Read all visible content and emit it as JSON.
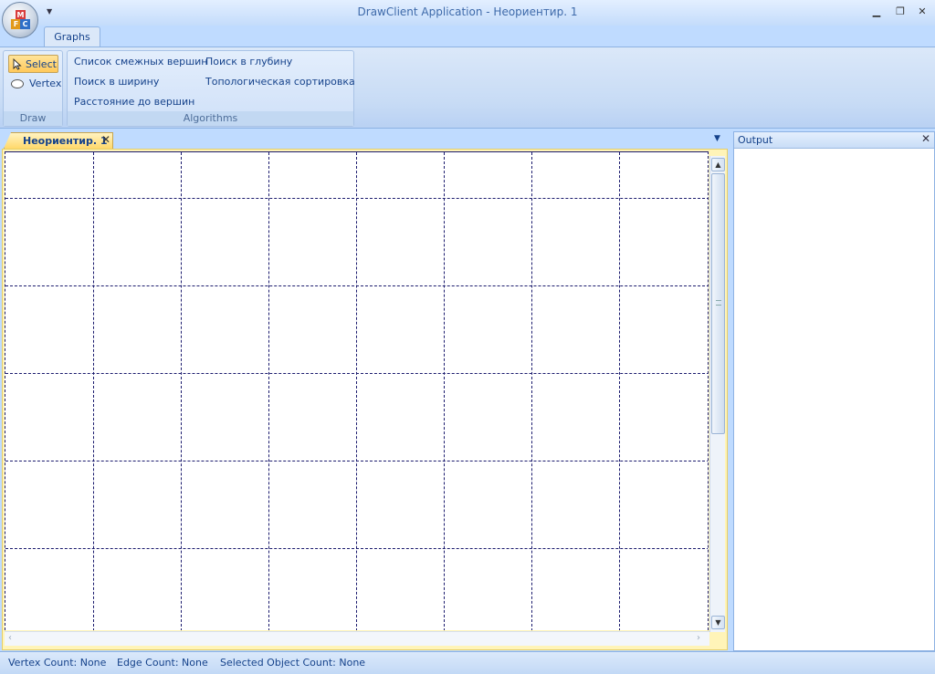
{
  "window": {
    "title": "DrawClient Application - Неориентир. 1",
    "orb_letters": [
      "M",
      "F",
      "C"
    ]
  },
  "ribbon": {
    "tabs": [
      {
        "label": "Graphs"
      }
    ],
    "groups": {
      "draw": {
        "caption": "Draw",
        "select_label": "Select",
        "vertex_label": "Vertex"
      },
      "algorithms": {
        "caption": "Algorithms",
        "items": [
          "Список смежных вершин",
          "Поиск в ширину",
          "Расстояние до вершин",
          "Поиск в глубину",
          "Топологическая сортировка"
        ]
      }
    }
  },
  "document": {
    "tab_label": "Неориентир. 1",
    "grid": "dashed",
    "grid_color": "#1b1b6e"
  },
  "output": {
    "title": "Output"
  },
  "status": {
    "vertex_count": "Vertex Count: None",
    "edge_count": "Edge Count: None",
    "selected_count": "Selected Object Count: None"
  },
  "colors": {
    "ribbon_text": "#15428b",
    "frame": "#bfdbff",
    "active_tab": "#ffd86a"
  }
}
